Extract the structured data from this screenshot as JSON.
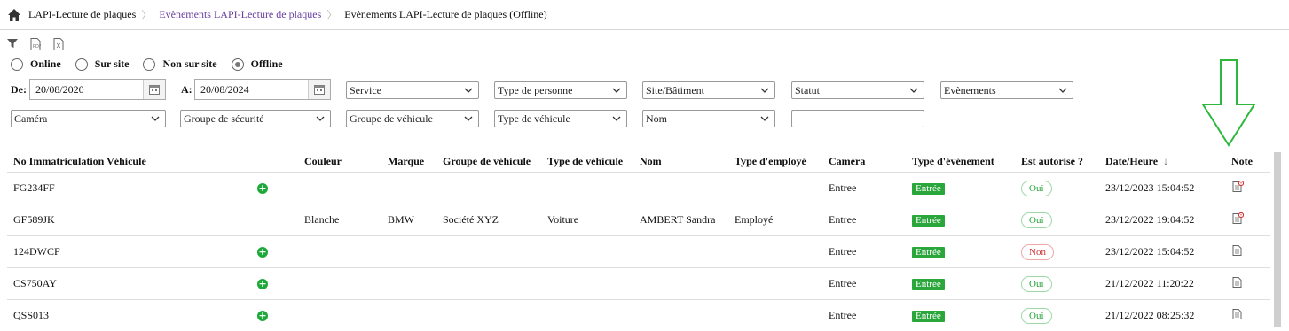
{
  "breadcrumb": {
    "items": [
      "LAPI-Lecture de plaques",
      "Evènements LAPI-Lecture de plaques",
      "Evènements LAPI-Lecture de plaques (Offline)"
    ]
  },
  "mode_options": [
    {
      "label": "Online",
      "checked": false
    },
    {
      "label": "Sur site",
      "checked": false
    },
    {
      "label": "Non sur site",
      "checked": false
    },
    {
      "label": "Offline",
      "checked": true
    }
  ],
  "filters": {
    "from_label": "De:",
    "from_value": "20/08/2020",
    "to_label": "A:",
    "to_value": "20/08/2024",
    "service": "Service",
    "type_personne": "Type de personne",
    "site_batiment": "Site/Bâtiment",
    "statut": "Statut",
    "evenements": "Evènements",
    "camera": "Caméra",
    "groupe_securite": "Groupe de sécurité",
    "groupe_vehicule": "Groupe de véhicule",
    "type_vehicule": "Type de véhicule",
    "nom": "Nom"
  },
  "table": {
    "headers": {
      "plate": "No Immatriculation Véhicule",
      "couleur": "Couleur",
      "marque": "Marque",
      "groupe": "Groupe de véhicule",
      "type": "Type de véhicule",
      "nom": "Nom",
      "employe": "Type d'employé",
      "camera": "Caméra",
      "event": "Type d'événement",
      "auth": "Est autorisé ?",
      "date": "Date/Heure",
      "date_sort": "↓",
      "note": "Note"
    },
    "rows": [
      {
        "plate": "FG234FF",
        "add": true,
        "couleur": "",
        "marque": "",
        "groupe": "",
        "type": "",
        "nom": "",
        "employe": "",
        "camera": "Entree",
        "event": "Entrée",
        "auth": "Oui",
        "date": "23/12/2023 15:04:52",
        "note_alert": true
      },
      {
        "plate": "GF589JK",
        "add": false,
        "couleur": "Blanche",
        "marque": "BMW",
        "groupe": "Société XYZ",
        "type": "Voiture",
        "nom": "AMBERT Sandra",
        "employe": "Employé",
        "camera": "Entree",
        "event": "Entrée",
        "auth": "Oui",
        "date": "23/12/2022 19:04:52",
        "note_alert": true
      },
      {
        "plate": "124DWCF",
        "add": true,
        "couleur": "",
        "marque": "",
        "groupe": "",
        "type": "",
        "nom": "",
        "employe": "",
        "camera": "Entree",
        "event": "Entrée",
        "auth": "Non",
        "date": "23/12/2022 15:04:52",
        "note_alert": false
      },
      {
        "plate": "CS750AY",
        "add": true,
        "couleur": "",
        "marque": "",
        "groupe": "",
        "type": "",
        "nom": "",
        "employe": "",
        "camera": "Entree",
        "event": "Entrée",
        "auth": "Oui",
        "date": "21/12/2022 11:20:22",
        "note_alert": false
      },
      {
        "plate": "QSS013",
        "add": true,
        "couleur": "",
        "marque": "",
        "groupe": "",
        "type": "",
        "nom": "",
        "employe": "",
        "camera": "Entree",
        "event": "Entrée",
        "auth": "Oui",
        "date": "21/12/2022 08:25:32",
        "note_alert": false
      }
    ]
  },
  "icons": {
    "home": "home-icon",
    "filter": "filter-icon",
    "pdf": "pdf-export-icon",
    "excel": "excel-export-icon",
    "calendar": "calendar-icon",
    "add": "add-circle-icon",
    "note": "note-icon",
    "annotation_arrow": "down-arrow-annotation"
  },
  "colors": {
    "entree_badge": "#2aa63b",
    "oui_text": "#2aa63b",
    "non_text": "#d03030",
    "link": "#6a3fa0",
    "annotation_arrow": "#2db83d"
  }
}
